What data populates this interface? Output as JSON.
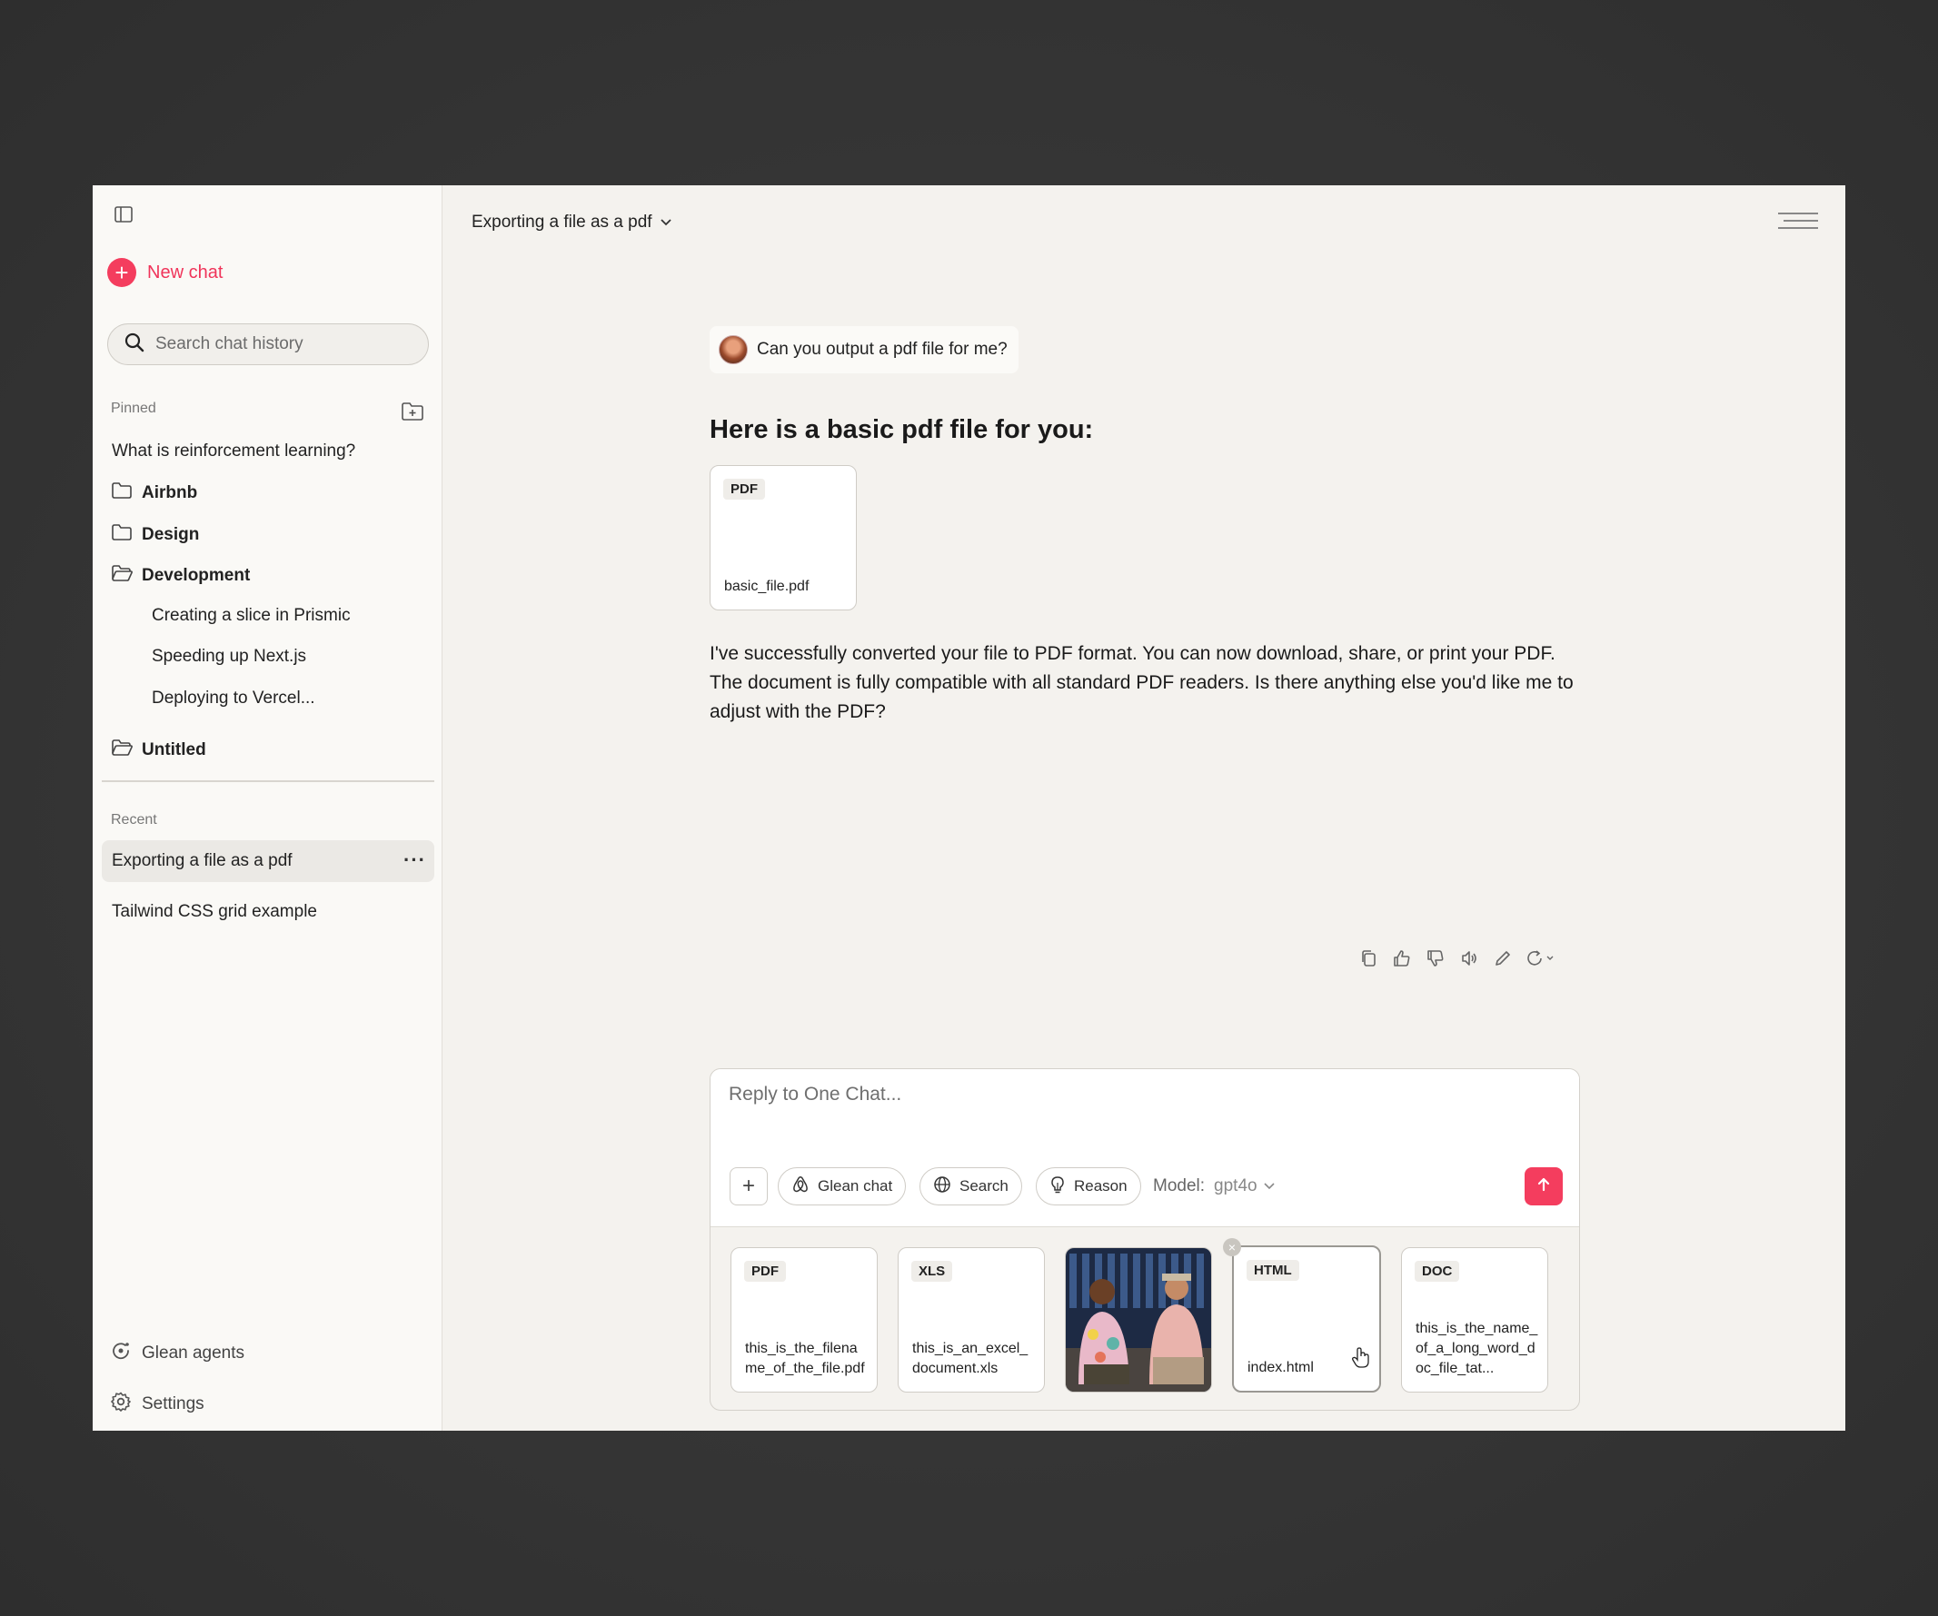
{
  "sidebar": {
    "new_chat": "New chat",
    "search_placeholder": "Search chat history",
    "pinned_label": "Pinned",
    "pinned": [
      {
        "label": "What is reinforcement learning?"
      }
    ],
    "folders": [
      {
        "label": "Airbnb"
      },
      {
        "label": "Design"
      },
      {
        "label": "Development",
        "children": [
          {
            "label": "Creating a slice in Prismic"
          },
          {
            "label": "Speeding up Next.js"
          },
          {
            "label": "Deploying to Vercel..."
          }
        ]
      },
      {
        "label": "Untitled"
      }
    ],
    "recent_label": "Recent",
    "recent": [
      {
        "label": "Exporting a file as a pdf",
        "active": true
      },
      {
        "label": "Tailwind CSS grid example"
      }
    ],
    "bottom": {
      "agents": "Glean agents",
      "settings": "Settings"
    }
  },
  "header": {
    "chat_title": "Exporting a file as a pdf"
  },
  "conversation": {
    "user_message": "Can you output a pdf file for me?",
    "assistant_heading": "Here is a basic pdf file for you:",
    "attachment": {
      "type": "PDF",
      "name": "basic_file.pdf"
    },
    "assistant_text": "I've successfully converted your file to PDF format. You can now download, share, or print your PDF. The document is fully compatible with all standard PDF readers. Is there anything else you'd like me to adjust with the PDF?",
    "actions": [
      "copy-icon",
      "thumbs-up-icon",
      "thumbs-down-icon",
      "speaker-icon",
      "edit-icon",
      "regenerate-icon"
    ]
  },
  "composer": {
    "placeholder": "Reply to One Chat...",
    "pills": {
      "glean_chat": "Glean chat",
      "search": "Search",
      "reason": "Reason"
    },
    "model_label": "Model:",
    "model_value": "gpt4o",
    "attachments": [
      {
        "type": "PDF",
        "name": "this_is_the_filename_of_the_file.pdf"
      },
      {
        "type": "XLS",
        "name": "this_is_an_excel_document.xls"
      },
      {
        "type": "image",
        "name": ""
      },
      {
        "type": "HTML",
        "name": "index.html"
      },
      {
        "type": "DOC",
        "name": "this_is_the_name_of_a_long_word_doc_file_tat..."
      }
    ]
  },
  "colors": {
    "accent": "#f43d5e",
    "window_bg": "#f4f2ee",
    "sidebar_bg": "#faf9f6",
    "backdrop": "#353535"
  }
}
